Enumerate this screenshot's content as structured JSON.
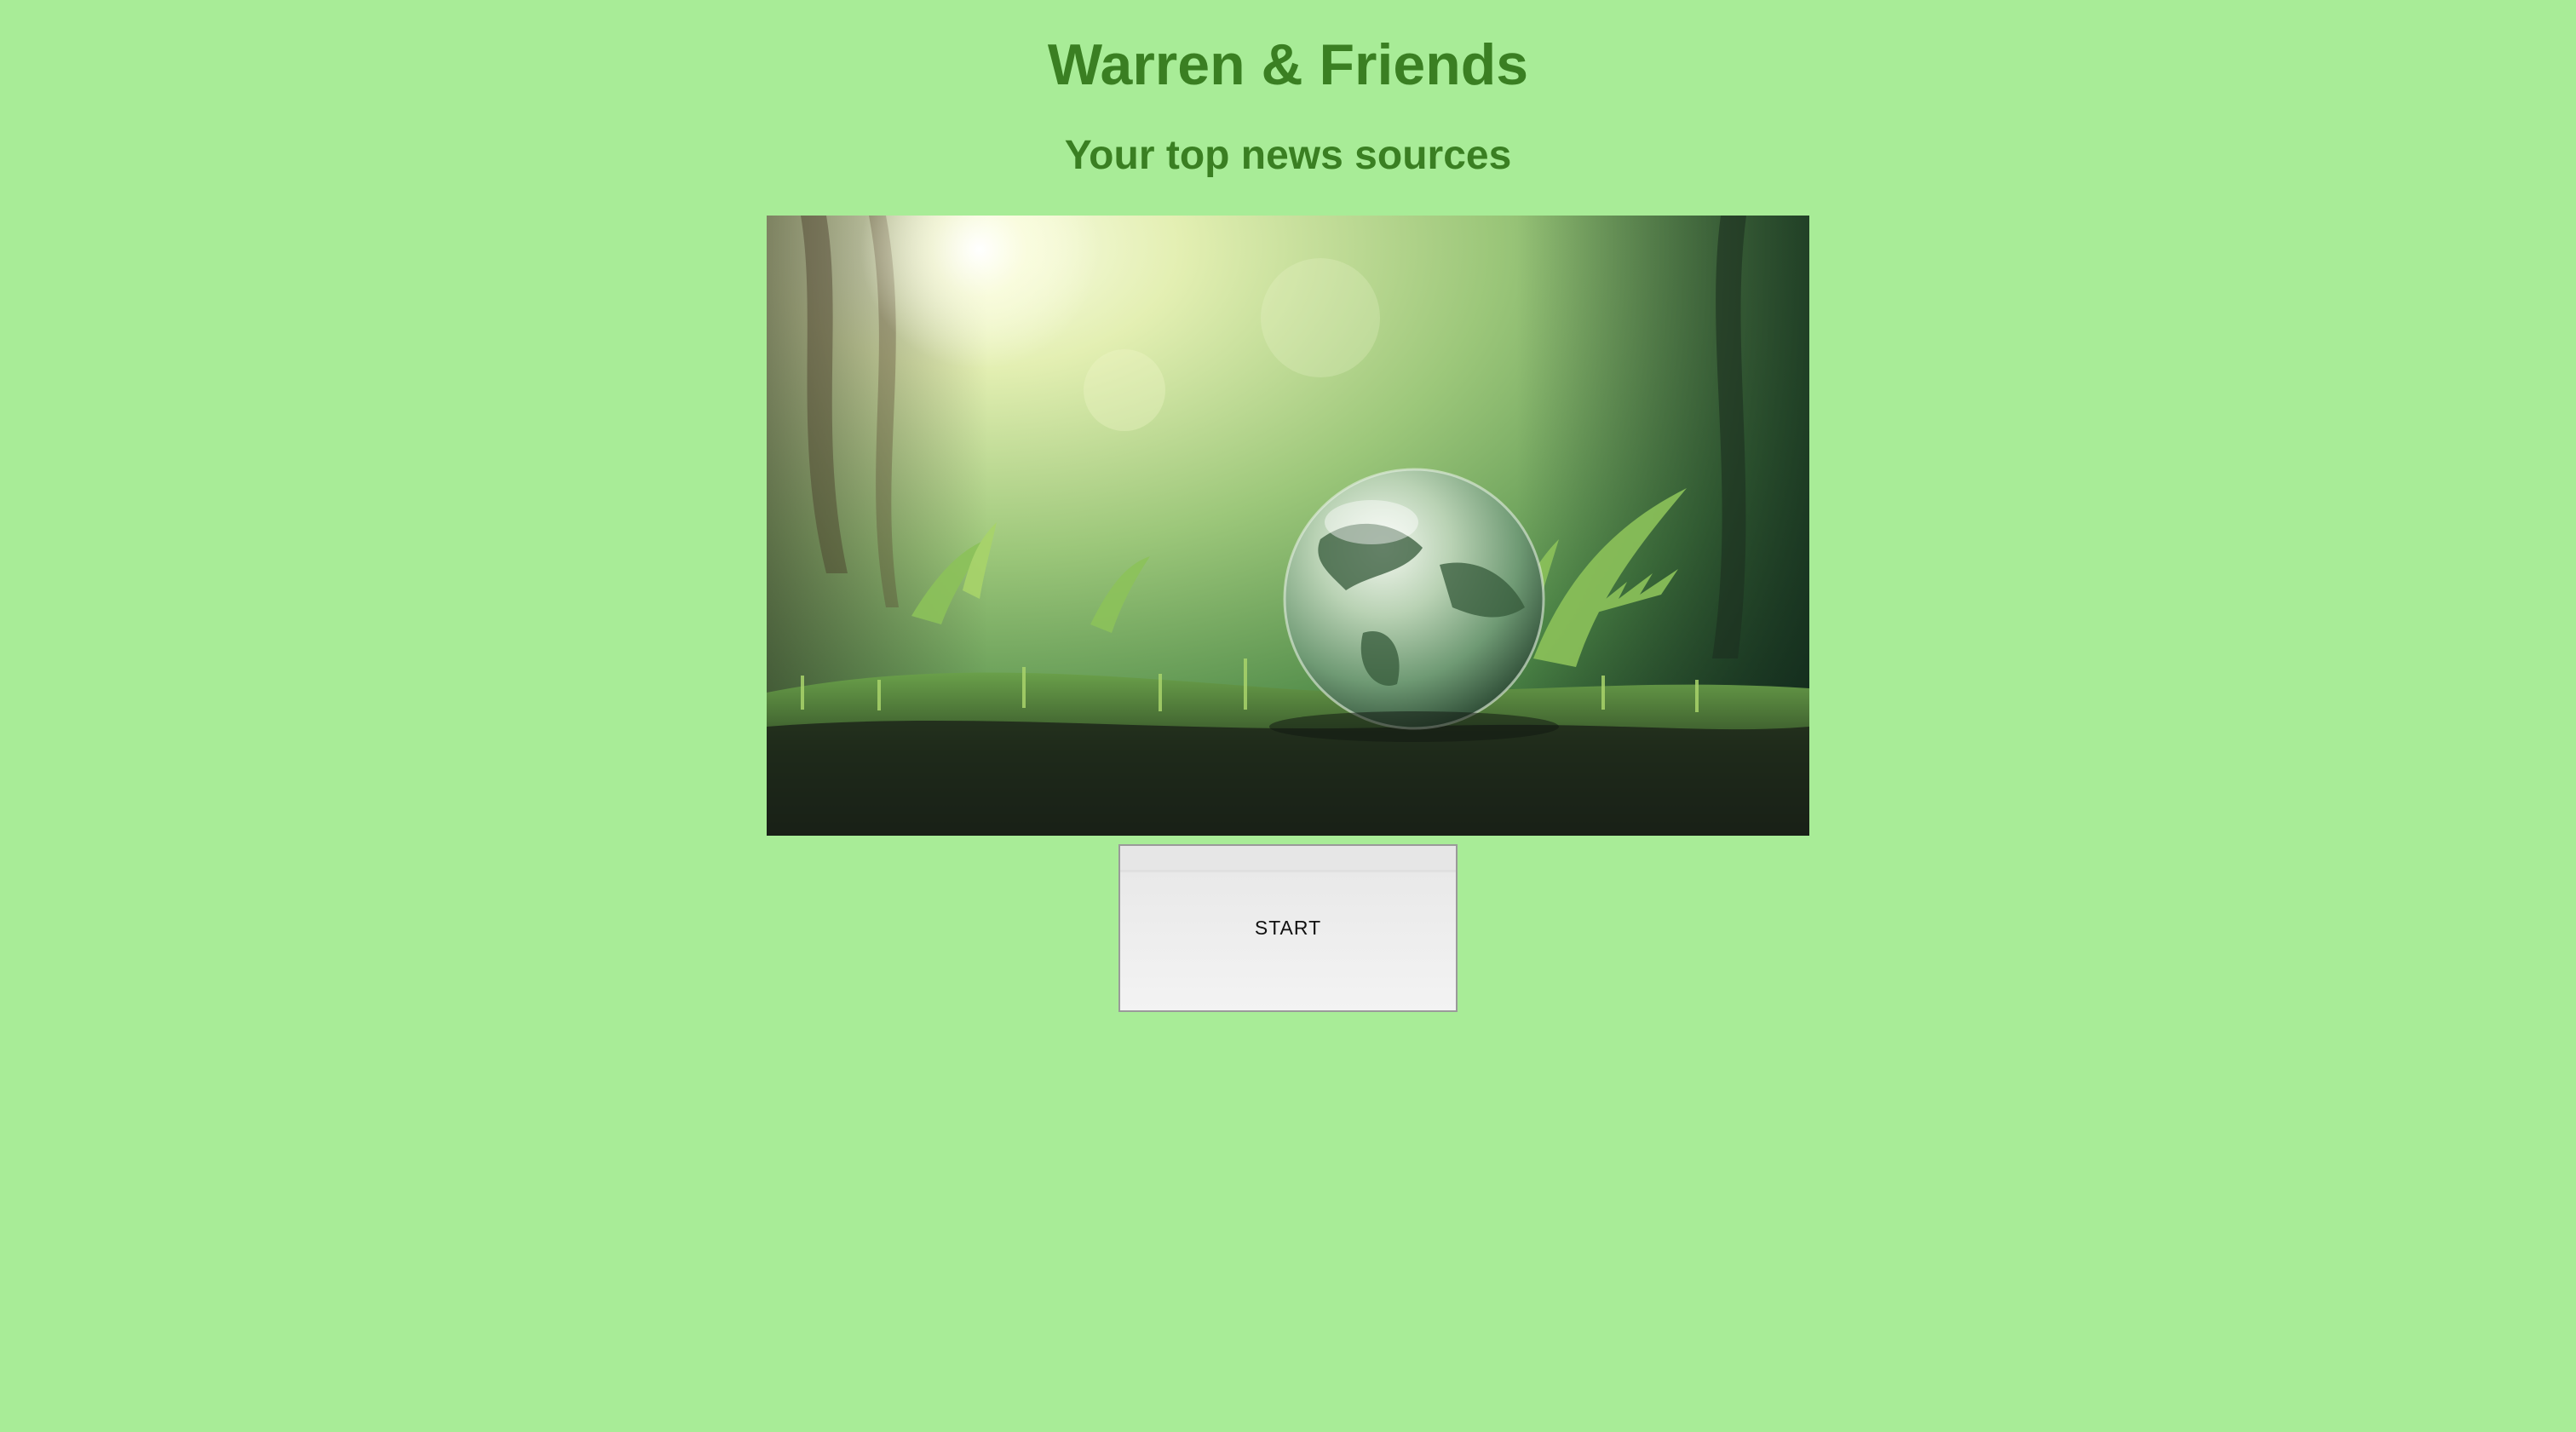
{
  "header": {
    "title": "Warren & Friends",
    "subtitle": "Your top news sources"
  },
  "hero_image": {
    "icon": "globe-in-forest-photo",
    "colors": {
      "light": "#f4f8d2",
      "foliage": "#7fb25a",
      "dark": "#1f3a1a"
    }
  },
  "actions": {
    "start_label": "START"
  },
  "theme": {
    "background": "#a8ec97",
    "heading_color": "#3a7f22"
  }
}
